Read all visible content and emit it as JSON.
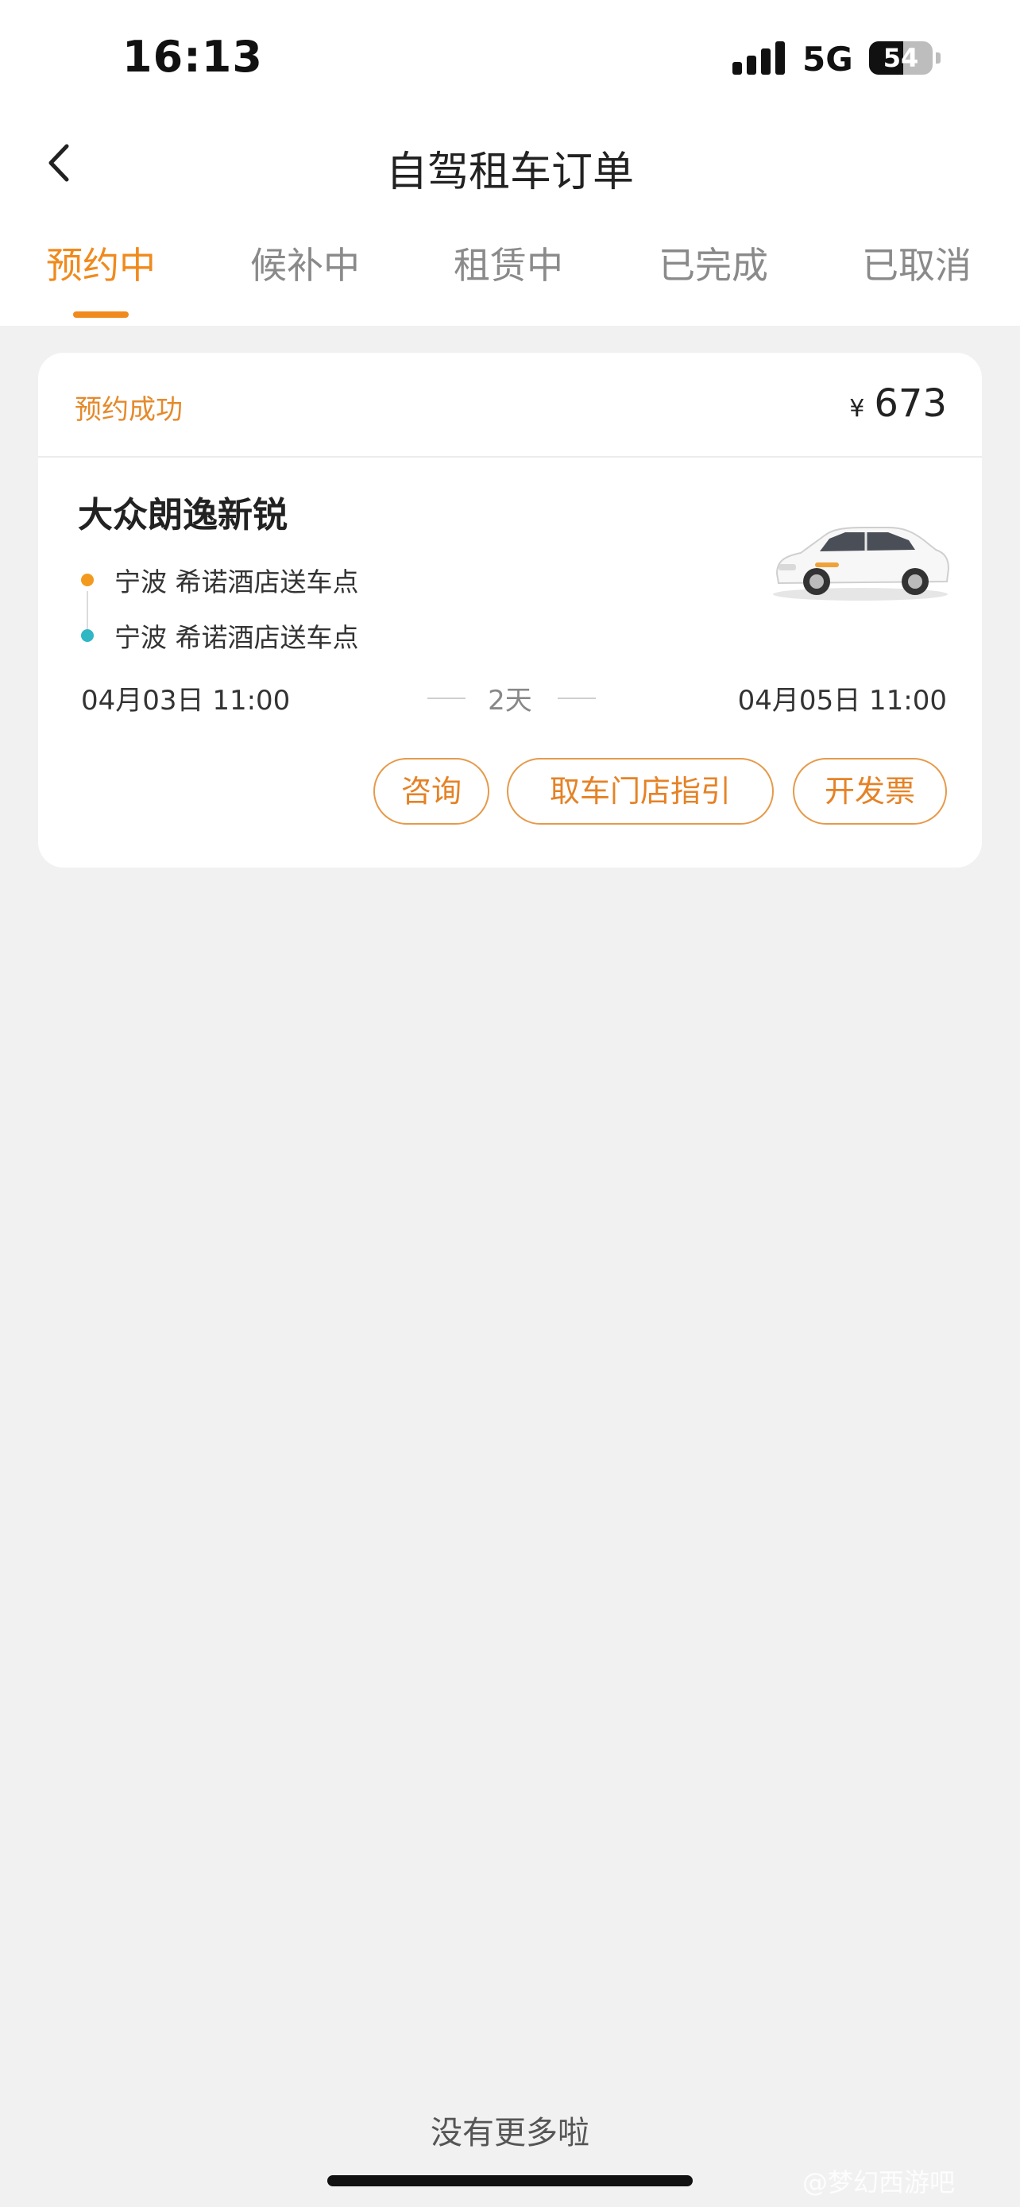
{
  "status_bar": {
    "time": "16:13",
    "network": "5G",
    "battery": "54",
    "battery_level": 0.54
  },
  "header": {
    "title": "自驾租车订单",
    "back_icon": "chevron-left-icon"
  },
  "tabs": [
    {
      "label": "预约中",
      "active": true
    },
    {
      "label": "候补中",
      "active": false
    },
    {
      "label": "租赁中",
      "active": false
    },
    {
      "label": "已完成",
      "active": false
    },
    {
      "label": "已取消",
      "active": false
    }
  ],
  "order": {
    "status": "预约成功",
    "currency": "¥",
    "price": "673",
    "car_name": "大众朗逸新锐",
    "pickup_location": "宁波 希诺酒店送车点",
    "return_location": "宁波 希诺酒店送车点",
    "start_time": "04月03日 11:00",
    "duration": "2天",
    "end_time": "04月05日 11:00",
    "buttons": {
      "consult": "咨询",
      "store_guide": "取车门店指引",
      "invoice": "开发票"
    }
  },
  "footer": {
    "no_more": "没有更多啦",
    "watermark": "@梦幻西游吧"
  },
  "colors": {
    "accent": "#f08a1c",
    "pickup_dot": "#f39a1e",
    "return_dot": "#2fb7c4",
    "background": "#f0f1f0"
  }
}
